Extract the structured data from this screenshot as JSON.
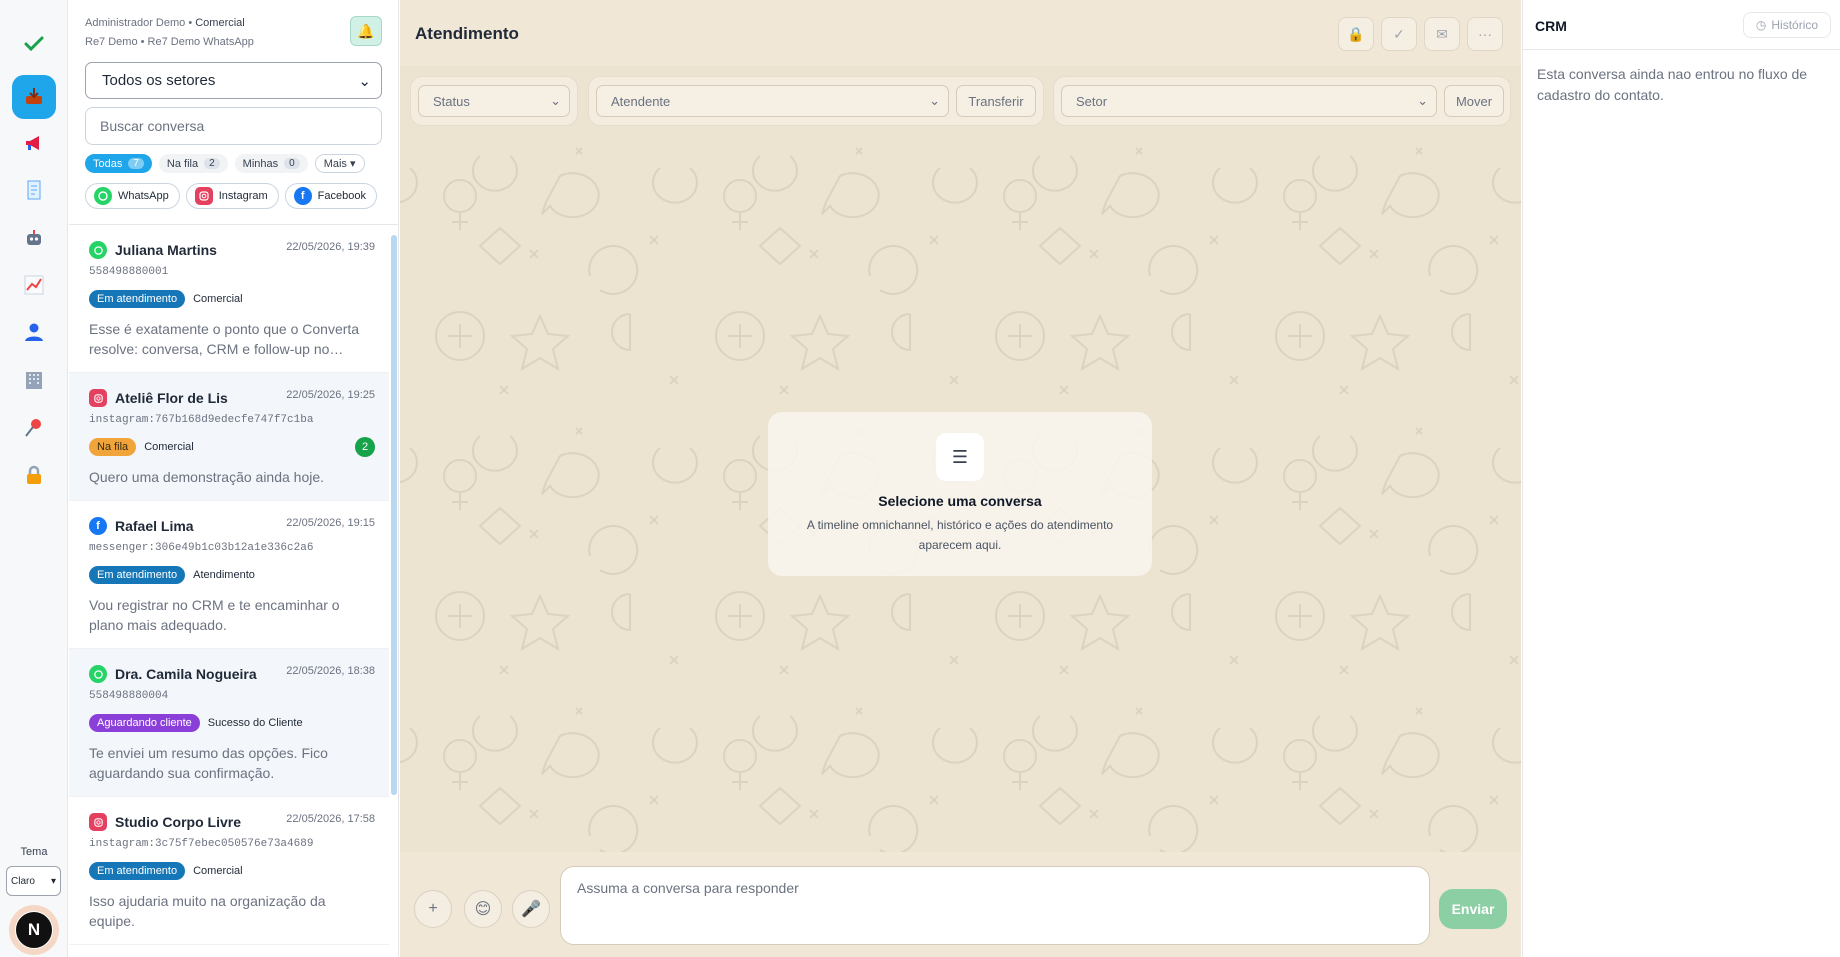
{
  "header": {
    "user_line_prefix": "Administrador Demo • ",
    "user_sector": "Comercial",
    "account_line": "Re7 Demo • Re7 Demo WhatsApp"
  },
  "sidebar": {
    "icons": [
      "check-icon",
      "inbox-icon",
      "megaphone-icon",
      "receipt-icon",
      "robot-icon",
      "chart-icon",
      "user-icon",
      "building-icon",
      "pin-icon",
      "lock-icon"
    ],
    "accent": "#1fa5e9",
    "tema_label": "Tema",
    "tema_value": "Claro",
    "avatar_letter": "N"
  },
  "list": {
    "setor_select": "Todos os setores",
    "search_placeholder": "Buscar conversa",
    "filters": [
      {
        "label": "Todas",
        "count": "7"
      },
      {
        "label": "Na fila",
        "count": "2"
      },
      {
        "label": "Minhas",
        "count": "0"
      },
      {
        "label": "Mais ▾"
      }
    ],
    "channels": [
      "WhatsApp",
      "Instagram",
      "Facebook"
    ],
    "conversations": [
      {
        "name": "Juliana Martins",
        "channel": "whatsapp",
        "time": "22/05/2026, 19:39",
        "id": "558498880001",
        "status": "Em atendimento",
        "status_color": "blue",
        "sector": "Comercial",
        "message": "Esse é exatamente o ponto que o Converta resolve: conversa, CRM e follow-up no…"
      },
      {
        "name": "Ateliê Flor de Lis",
        "channel": "instagram",
        "time": "22/05/2026, 19:25",
        "id": "instagram:767b168d9edecfe747f7c1ba",
        "status": "Na fila",
        "status_color": "orange",
        "sector": "Comercial",
        "unread": "2",
        "message": "Quero uma demonstração ainda hoje."
      },
      {
        "name": "Rafael Lima",
        "channel": "facebook",
        "time": "22/05/2026, 19:15",
        "id": "messenger:306e49b1c03b12a1e336c2a6",
        "status": "Em atendimento",
        "status_color": "blue",
        "sector": "Atendimento",
        "message": "Vou registrar no CRM e te encaminhar o plano mais adequado."
      },
      {
        "name": "Dra. Camila Nogueira",
        "channel": "whatsapp",
        "time": "22/05/2026, 18:38",
        "id": "558498880004",
        "status": "Aguardando cliente",
        "status_color": "purple",
        "sector": "Sucesso do Cliente",
        "message": "Te enviei um resumo das opções. Fico aguardando sua confirmação."
      },
      {
        "name": "Studio Corpo Livre",
        "channel": "instagram",
        "time": "22/05/2026, 17:58",
        "id": "instagram:3c75f7ebec050576e73a4689",
        "status": "Em atendimento",
        "status_color": "blue",
        "sector": "Comercial",
        "message": "Isso ajudaria muito na organização da equipe."
      }
    ]
  },
  "main": {
    "title": "Atendimento",
    "status_placeholder": "Status",
    "atendente_placeholder": "Atendente",
    "transferir_label": "Transferir",
    "setor_placeholder": "Setor",
    "mover_label": "Mover",
    "empty_title": "Selecione uma conversa",
    "empty_text": "A timeline omnichannel, histórico e ações do atendimento aparecem aqui.",
    "reply_placeholder": "Assuma a conversa para responder",
    "send_label": "Enviar"
  },
  "crm": {
    "title": "CRM",
    "history_label": "Histórico",
    "message": "Esta conversa ainda nao entrou no fluxo de cadastro do contato."
  }
}
